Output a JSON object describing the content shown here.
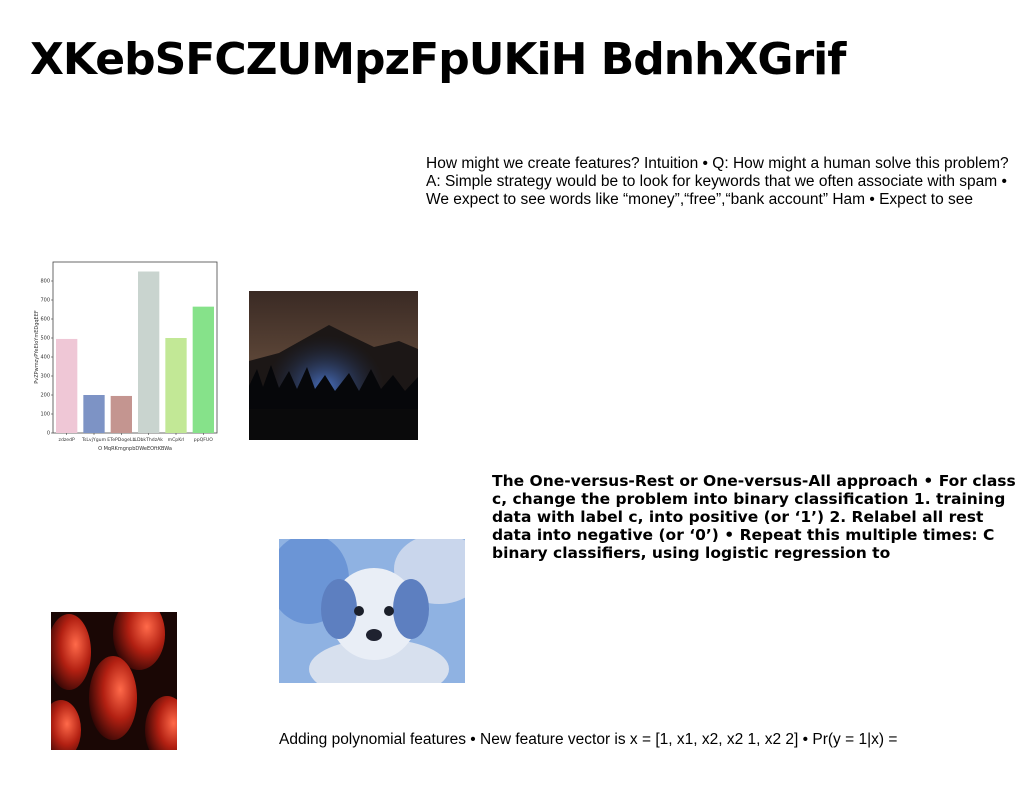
{
  "slide": {
    "title": "XKebSFCZUMpzFpUKiH BdnhXGrif",
    "paragraphs": [
      "How might we create features? Intuition • Q: How might a human solve this problem? A: Simple strategy would be to look for keywords that we often associate with spam • We expect to see words like “money”,“free”,“bank account” Ham • Expect to see",
      "The One-versus-Rest or One-versus-All approach • For class c, change the problem into binary classification 1. training data with label c, into positive (or ‘1’) 2. Relabel all rest data into negative (or ‘0’) • Repeat this multiple times: C binary classifiers, using logistic regression to",
      "Adding polynomial features • New feature vector is x = [1, x1, x2, x2 1, x2 2] • Pr(y = 1|x) ="
    ]
  },
  "chart_data": {
    "type": "bar",
    "categories": [
      "zdzedP",
      "TsLvjYgum",
      "ETePDogeLb",
      "LDbkThdzAk",
      "mCpKrl",
      "ppQFUO"
    ],
    "values": [
      495,
      200,
      195,
      850,
      500,
      665
    ],
    "colors": [
      "#efc7d6",
      "#7d93c5",
      "#c49590",
      "#c9d4cf",
      "#c2e896",
      "#86e28a"
    ],
    "xlabel": "O MqRKmgnpbDWeEOftKBWa",
    "ylabel": "PvZPwmzyPYeEIoYmEDgqEEF",
    "ylim": [
      0,
      900
    ],
    "yticks": [
      0,
      100,
      200,
      300,
      400,
      500,
      600,
      700,
      800
    ]
  }
}
